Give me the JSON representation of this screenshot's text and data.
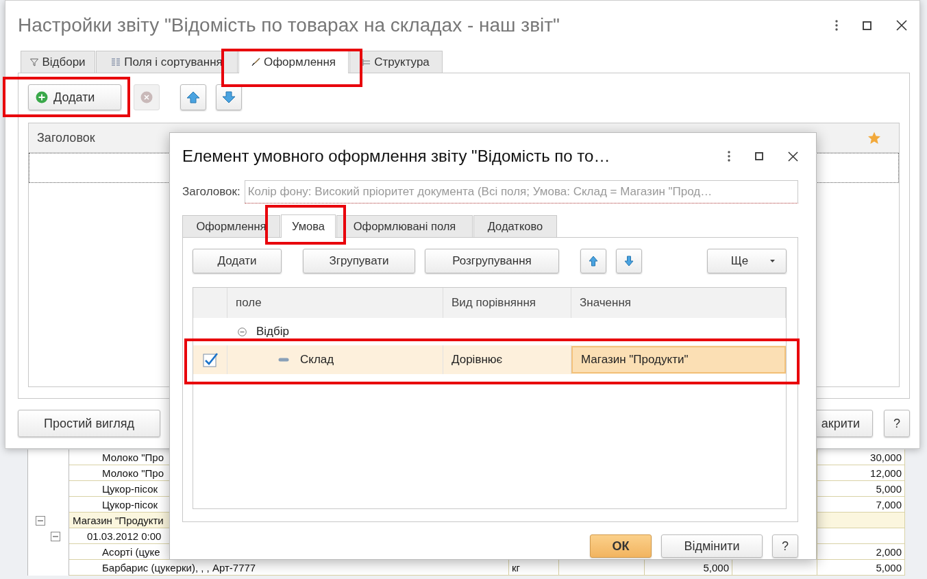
{
  "report": {
    "rows": [
      {
        "kind": "item",
        "label": "Молоко \"Про",
        "unit": "",
        "quantity": "",
        "total": "30,000"
      },
      {
        "kind": "item",
        "label": "Молоко \"Про",
        "unit": "",
        "quantity": "",
        "total": "12,000"
      },
      {
        "kind": "item",
        "label": "Цукор-пісок",
        "unit": "",
        "quantity": "",
        "total": "5,000"
      },
      {
        "kind": "item",
        "label": "Цукор-пісок",
        "unit": "",
        "quantity": "",
        "total": "7,000"
      },
      {
        "kind": "group",
        "label": "Магазин \"Продукти",
        "unit": "",
        "quantity": "",
        "total": ""
      },
      {
        "kind": "date",
        "label": "01.03.2012 0:00",
        "unit": "",
        "quantity": "",
        "total": ""
      },
      {
        "kind": "item",
        "label": "Асорті (цуке",
        "unit": "",
        "quantity": "",
        "total": "2,000"
      },
      {
        "kind": "item",
        "label": "Барбарис (цукерки), , , Арт-7777",
        "unit": "кг",
        "quantity": "5,000",
        "total": "5,000"
      }
    ]
  },
  "settings": {
    "title": "Настройки звіту \"Відомість по товарах на складах - наш звіт\"",
    "tabs": [
      {
        "label": "Відбори",
        "selected": false
      },
      {
        "label": "Поля і сортування",
        "selected": false
      },
      {
        "label": "Оформлення",
        "selected": true
      },
      {
        "label": "Структура",
        "selected": false
      }
    ],
    "toolbar": {
      "add_label": "Додати",
      "delete_disabled": true
    },
    "table": {
      "columns": [
        "Заголовок"
      ],
      "rows": [
        {
          "selected": true
        }
      ]
    },
    "footer": {
      "simple_view": "Простий вигляд",
      "close": "акрити",
      "help": "?"
    }
  },
  "dialog": {
    "title": "Елемент умовного оформлення звіту \"Відомість по то…",
    "caption_label": "Заголовок:",
    "caption_placeholder": "Колір фону: Високий пріоритет документа (Всі поля; Умова: Склад = Магазин \"Прод…",
    "tabs": [
      {
        "label": "Оформлення",
        "selected": false
      },
      {
        "label": "Умова",
        "selected": true
      },
      {
        "label": "Оформлювані поля",
        "selected": false
      },
      {
        "label": "Додатково",
        "selected": false
      }
    ],
    "buttons": [
      "Додати",
      "Згрупувати",
      "Розгрупування"
    ],
    "more": "Ще",
    "columns": [
      "поле",
      "Вид порівняння",
      "Значення"
    ],
    "rows": [
      {
        "kind": "group",
        "field": "Відбір",
        "expanded": true
      },
      {
        "kind": "condition",
        "checked": true,
        "selected": true,
        "field": "Склад",
        "comparison": "Дорівнює",
        "value": "Магазин \"Продукти\""
      }
    ],
    "footer": {
      "ok": "ОК",
      "cancel": "Відмінити",
      "help": "?"
    }
  }
}
